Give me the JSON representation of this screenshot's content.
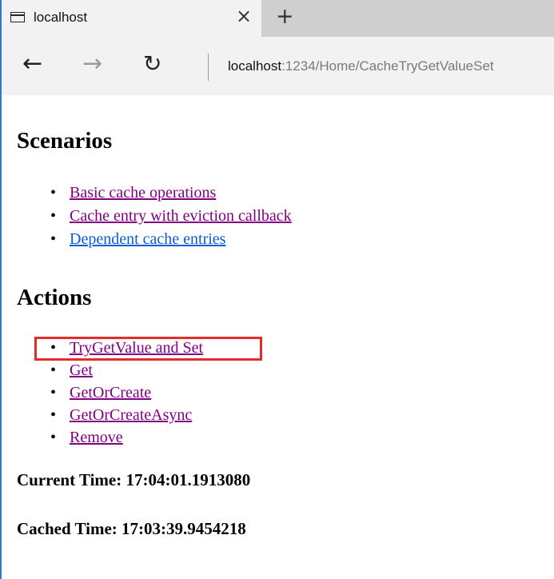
{
  "browser": {
    "tab_title": "localhost",
    "tab_close_glyph": "×",
    "new_tab_glyph": "+",
    "back_glyph": "←",
    "forward_glyph": "→",
    "refresh_glyph": "↻",
    "address_host": "localhost",
    "address_path": ":1234/Home/CacheTryGetValueSet",
    "icons": [
      "tab-page-icon",
      "close-icon",
      "plus-icon",
      "back-arrow-icon",
      "forward-arrow-icon",
      "refresh-icon"
    ]
  },
  "page": {
    "scenarios_heading": "Scenarios",
    "scenarios": [
      {
        "label": "Basic cache operations",
        "visited": true
      },
      {
        "label": "Cache entry with eviction callback",
        "visited": true
      },
      {
        "label": "Dependent cache entries",
        "visited": false
      }
    ],
    "actions_heading": "Actions",
    "actions": [
      {
        "label": "TryGetValue and Set",
        "highlighted": true
      },
      {
        "label": "Get"
      },
      {
        "label": "GetOrCreate"
      },
      {
        "label": "GetOrCreateAsync"
      },
      {
        "label": "Remove"
      }
    ],
    "current_time": "Current Time: 17:04:01.1913080",
    "cached_time": "Cached Time: 17:03:39.9454218"
  },
  "colors": {
    "visited_link": "#800080",
    "unvisited_link": "#0b5cd8",
    "highlight_box": "#e52b2b"
  }
}
